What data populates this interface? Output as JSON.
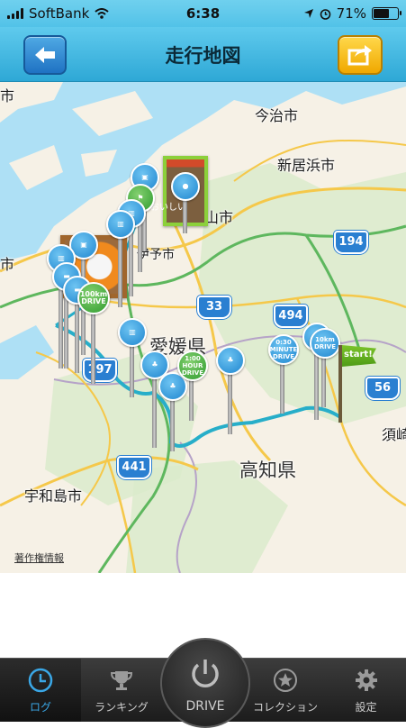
{
  "status": {
    "carrier": "SoftBank",
    "time": "6:38",
    "battery": "71%",
    "battery_level": 0.71
  },
  "nav": {
    "title": "走行地図",
    "back_icon": "arrow-left-icon",
    "share_icon": "share-arrow-icon"
  },
  "map": {
    "places": {
      "imabari": "今治市",
      "niihama": "新居浜市",
      "matsuyama_partial": "山市",
      "iyo": "伊予市",
      "ehime": "愛媛県",
      "kochi_pref": "高知県",
      "uwajima": "宇和島市",
      "left_edge_1": "市",
      "left_edge_2": "市",
      "susaki_partial": "須崎"
    },
    "routes": {
      "r194": "194",
      "r33": "33",
      "r494": "494",
      "r56": "56",
      "r441": "441",
      "r197_partial": "197"
    },
    "credit": "著作権情報",
    "pins": {
      "drive_100km": "100km DRIVE",
      "hour_drive": "1:00 HOUR DRIVE",
      "minute_drive": "0:30 MINUTE DRIVE",
      "km10_drive": "10km DRIVE",
      "start_flag": "start!",
      "photo_caption": "おいしい"
    }
  },
  "tabs": [
    {
      "label": "ログ",
      "icon": "clock-icon"
    },
    {
      "label": "ランキング",
      "icon": "trophy-icon"
    },
    {
      "label": "DRIVE",
      "icon": "power-icon"
    },
    {
      "label": "コレクション",
      "icon": "star-icon"
    },
    {
      "label": "設定",
      "icon": "gear-icon"
    }
  ],
  "colors": {
    "navbar": "#2ea8d6",
    "route_line": "#27aec9",
    "active_tab": "#3aa7e6",
    "share_button": "#f0a800"
  }
}
